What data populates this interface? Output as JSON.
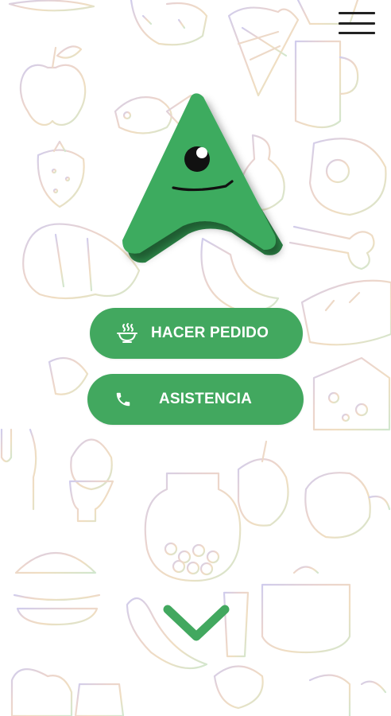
{
  "app": {
    "name": "A"
  },
  "header": {
    "menu_icon": "hamburger-menu-icon"
  },
  "actions": {
    "order": {
      "label": "HACER PEDIDO",
      "icon": "food-bowl-icon"
    },
    "support": {
      "label": "ASISTENCIA",
      "icon": "phone-icon"
    }
  },
  "footer": {
    "scroll_icon": "chevron-down-icon"
  },
  "colors": {
    "accent": "#42a85f",
    "logo_green": "#3dab5e",
    "text_on_accent": "#ffffff",
    "menu": "#222222"
  }
}
